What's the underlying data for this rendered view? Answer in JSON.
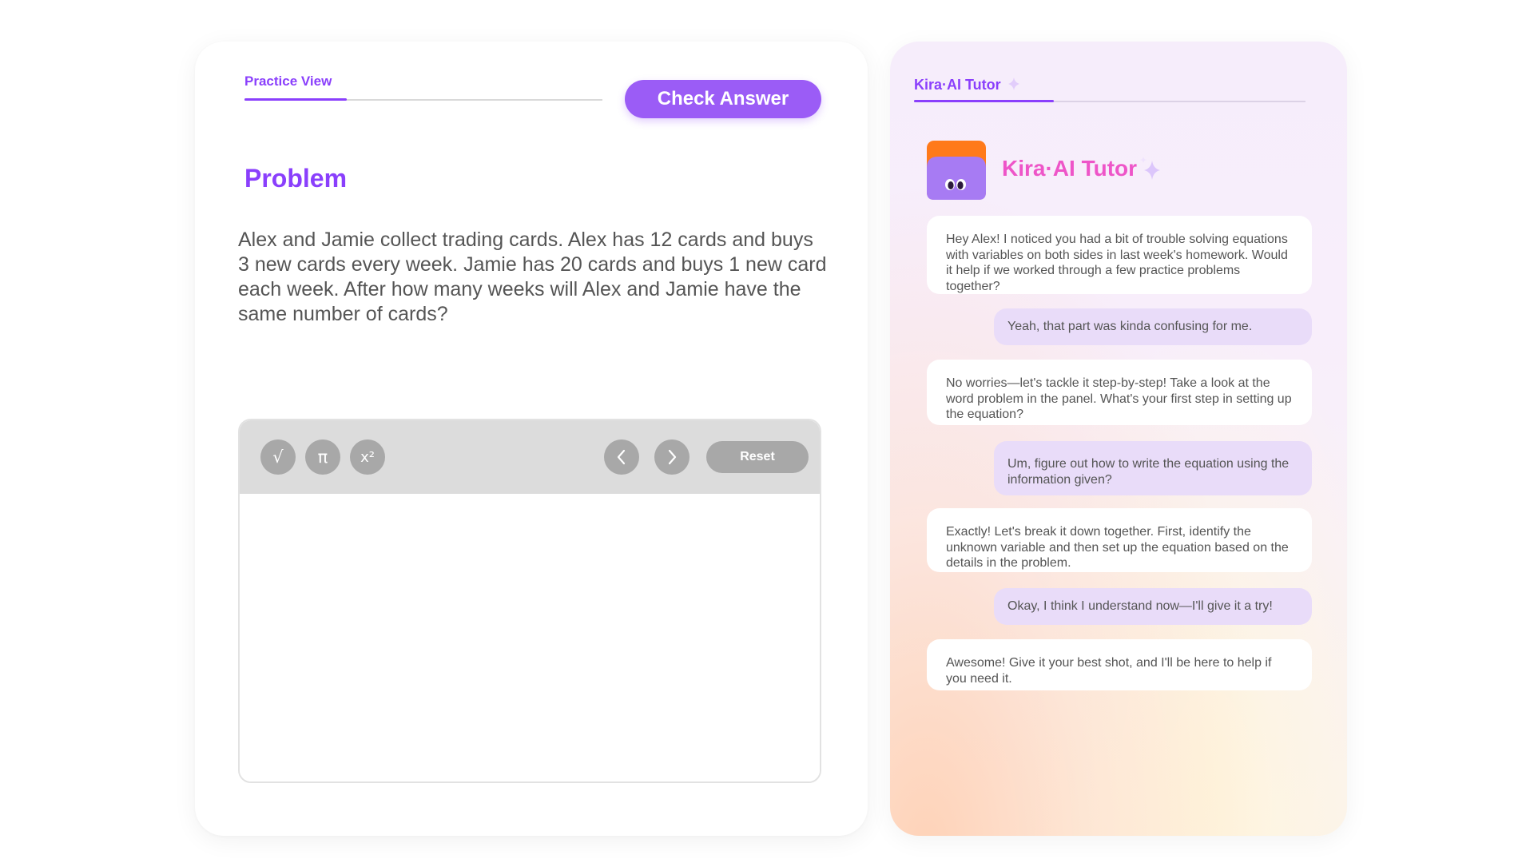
{
  "practice": {
    "tab_label": "Practice View",
    "check_answer_label": "Check Answer",
    "problem_title": "Problem",
    "problem_text": "Alex and Jamie collect trading cards. Alex has 12 cards and buys 3 new cards every week. Jamie has 20 cards and buys 1 new card each week. After how many weeks will Alex and Jamie have the same number of cards?",
    "toolbar": {
      "sqrt_symbol": "√",
      "pi_symbol": "π",
      "square_symbol": "x²",
      "prev_icon": "chevron-left-icon",
      "next_icon": "chevron-right-icon",
      "reset_label": "Reset"
    }
  },
  "tutor": {
    "tab_label": "Kira·AI Tutor",
    "name": "Kira·AI Tutor",
    "messages": [
      {
        "role": "bot",
        "text": "Hey Alex! I noticed you had a bit of trouble solving equations with variables on both sides in last week's homework. Would it help if we worked through a few practice problems together?"
      },
      {
        "role": "user",
        "text": "Yeah, that part was kinda confusing for me."
      },
      {
        "role": "bot",
        "text": "No worries—let's tackle it step-by-step! Take a look at the word problem in the panel. What's your first step in setting up the equation?"
      },
      {
        "role": "user",
        "text": "Um, figure out how to write the equation using the information given?"
      },
      {
        "role": "bot",
        "text": "Exactly! Let's break it down together. First, identify the unknown variable and then set up the equation based on the details in the problem."
      },
      {
        "role": "user",
        "text": "Okay, I think I understand now—I'll give it a try!"
      },
      {
        "role": "bot",
        "text": "Awesome! Give it your best shot, and I'll be here to help if you need it."
      }
    ]
  },
  "colors": {
    "accent_purple": "#8a3ffc",
    "button_purple": "#9b5cf6",
    "tutor_name_pink": "#ee55c8",
    "user_bubble": "#e9dcf9",
    "avatar_orange": "#ff7a1a",
    "avatar_purple": "#a77bf3"
  }
}
